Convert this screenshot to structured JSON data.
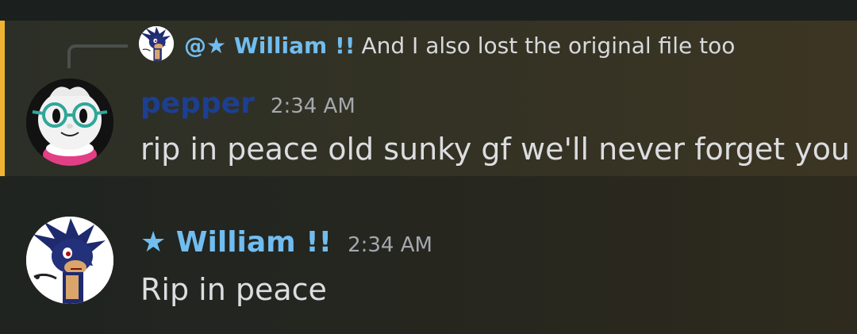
{
  "colors": {
    "highlight_bar": "#f0b232",
    "pepper_name": "#1c3f92",
    "william_name": "#71bdf0",
    "timestamp": "#a5a8ae",
    "message_text": "#dcdde0"
  },
  "reply": {
    "author": "@★ William !!",
    "text": "And I also lost the original file too",
    "avatar_icon": "hedgehog-avatar-icon"
  },
  "messages": [
    {
      "author": "pepper",
      "timestamp": "2:34 AM",
      "content": "rip in peace old sunky gf we'll never forget you",
      "avatar_icon": "plush-with-glasses-avatar-icon",
      "mentioned": true
    },
    {
      "author": "★ William !!",
      "timestamp": "2:34 AM",
      "content": "Rip in peace",
      "avatar_icon": "hedgehog-avatar-icon",
      "mentioned": false
    }
  ]
}
